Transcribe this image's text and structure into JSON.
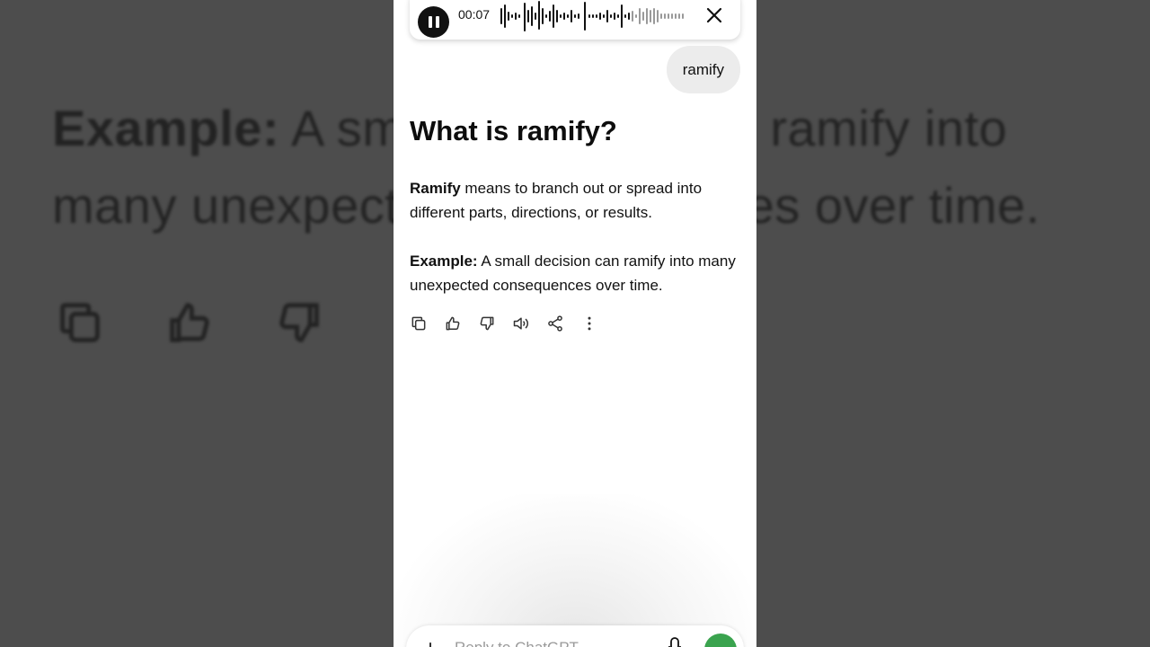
{
  "background": {
    "text_bold": "Example:",
    "text_rest": " A small decision can ramify into many unexpected consequences over time."
  },
  "audio": {
    "time": "00:07",
    "pause_icon": "pause-icon",
    "close_icon": "close-icon"
  },
  "conversation": {
    "user_message": "ramify",
    "heading": "What is ramify?",
    "definition_term": "Ramify",
    "definition_text": " means to branch out or spread into different parts, directions, or results.",
    "example_label": "Example:",
    "example_text": " A small decision can ramify into many unexpected consequences over time."
  },
  "actions": [
    "copy-icon",
    "thumbs-up-icon",
    "thumbs-down-icon",
    "read-aloud-icon",
    "share-icon",
    "more-icon"
  ],
  "composer": {
    "placeholder": "Reply to ChatGPT",
    "plus_label": "+",
    "accent": "#3aa34e"
  }
}
